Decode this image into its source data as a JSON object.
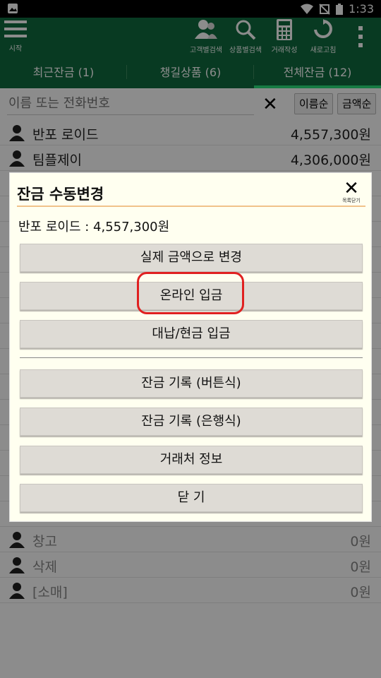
{
  "status_bar": {
    "time": "1:33"
  },
  "toolbar": {
    "menu_label": "시작",
    "actions": [
      {
        "icon": "people-icon",
        "label": "고객별검색"
      },
      {
        "icon": "search-icon",
        "label": "상품별검색"
      },
      {
        "icon": "calculator-icon",
        "label": "거래작성"
      },
      {
        "icon": "refresh-icon",
        "label": "새로고침"
      }
    ]
  },
  "tabs": [
    {
      "label": "최근잔금 (1)",
      "active": false
    },
    {
      "label": "챙길상품 (6)",
      "active": false
    },
    {
      "label": "전체잔금 (12)",
      "active": true
    }
  ],
  "search": {
    "placeholder": "이름 또는 전화번호",
    "sort_name": "이름순",
    "sort_amount": "금액순"
  },
  "list": {
    "top_rows": [
      {
        "name": "반포 로이드",
        "amount": "4,557,300원"
      },
      {
        "name": "팀플제이",
        "amount": "4,306,000원"
      }
    ],
    "bottom_rows": [
      {
        "name": "창고",
        "amount": "0원"
      },
      {
        "name": "삭제",
        "amount": "0원"
      },
      {
        "name": "[소매]",
        "amount": "0원"
      }
    ]
  },
  "dialog": {
    "title": "잔금 수동변경",
    "close_label": "목록닫기",
    "info": "반포 로이드 : 4,557,300원",
    "buttons": [
      "실제 금액으로 변경",
      "온라인 입금",
      "대납/현금 입금",
      "잔금 기록 (버튼식)",
      "잔금 기록 (은행식)",
      "거래처 정보",
      "닫  기"
    ]
  },
  "colors": {
    "toolbar": "#0f6b3f",
    "active_tab_indicator": "#28e07a",
    "highlight": "#e02020",
    "dialog_bg": "#fffff0"
  }
}
